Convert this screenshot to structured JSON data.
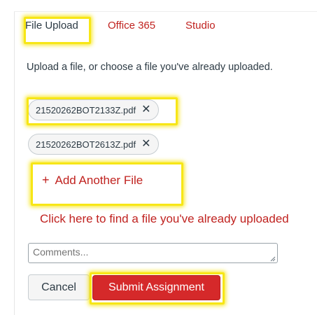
{
  "tabs": [
    {
      "label": "File Upload",
      "active": true
    },
    {
      "label": "Office 365",
      "active": false
    },
    {
      "label": "Studio",
      "active": false
    }
  ],
  "instruction": "Upload a file, or choose a file you've already uploaded.",
  "files": [
    {
      "name": "21520262BOT2133Z.pdf",
      "remove_glyph": "✕"
    },
    {
      "name": "21520262BOT2613Z.pdf",
      "remove_glyph": "✕"
    }
  ],
  "add_file": {
    "icon": "plus-icon",
    "label": "Add Another File"
  },
  "find_link": "Click here to find a file you've already uploaded",
  "comments": {
    "placeholder": "Comments..."
  },
  "buttons": {
    "cancel": "Cancel",
    "submit": "Submit Assignment"
  },
  "colors": {
    "link_red": "#c0221f",
    "submit_bg": "#d5292a",
    "highlight": "#f7e616",
    "text": "#2d3b45"
  }
}
